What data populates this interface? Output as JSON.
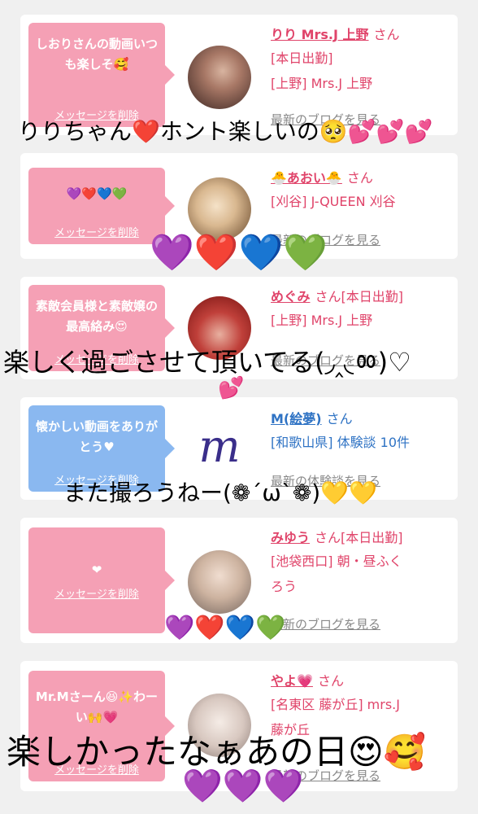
{
  "delete_label": "メッセージを削除",
  "cards": [
    {
      "bubble": "しおりさんの動画いつも楽しそ🥰",
      "bubble_color": "pink",
      "name": "りり Mrs.J 上野",
      "honorific": "さん",
      "lines": [
        "[本日出勤]",
        "[上野] Mrs.J 上野"
      ],
      "blog_link": "最新のブログを見る"
    },
    {
      "bubble": "💜❤️💙💚",
      "bubble_color": "pink",
      "name": "🐣あおい🐣",
      "honorific": "さん",
      "lines": [
        "[刈谷] J-QUEEN 刈谷"
      ],
      "blog_link": "最新のブログを見る"
    },
    {
      "bubble": "素敵会員様と素敵嬢の最高絡み😍",
      "bubble_color": "pink",
      "name": "めぐみ",
      "honorific": "さん[本日出勤]",
      "lines": [
        "[上野] Mrs.J 上野"
      ],
      "blog_link": "最新のブログを見る"
    },
    {
      "bubble": "懐かしい動画をありがとう♥",
      "bubble_color": "blue",
      "name": "M(絵夢)",
      "honorific": "さん",
      "lines": [
        "[和歌山県] 体験談 10件"
      ],
      "blog_link": "最新の体験談を見る"
    },
    {
      "bubble": "❤",
      "bubble_color": "pink",
      "name": "みゆう",
      "honorific": "さん[本日出勤]",
      "lines": [
        "[池袋西口] 朝・昼ふく",
        "ろう"
      ],
      "blog_link": "最新のブログを見る"
    },
    {
      "bubble": "Mr.Mさーん😆✨わーい🙌💗",
      "bubble_color": "pink",
      "name": "やよ💗",
      "honorific": "さん",
      "lines": [
        "[名東区 藤が丘] mrs.J",
        "藤が丘"
      ],
      "blog_link": "最新のブログを見る"
    }
  ],
  "overlays": [
    "りりちゃん❤️ホント楽しいの🥺💕💕💕",
    "💜❤️💙💚",
    "楽しく過ごさせて頂いてる(◞‸◟ㆀ)♡",
    "💕",
    "また撮ろうねー(❁´ω`❁)💛💛",
    "💜❤️💙💚",
    "楽しかったなぁあの日😍🥰",
    "💜💜💜"
  ],
  "avatar_letter": "m",
  "colors": {
    "pink_bubble": "#f5a0b5",
    "blue_bubble": "#8ab8f0",
    "pink_text": "#e0446a",
    "blue_text": "#2f73c4",
    "background": "#f0f0f0"
  }
}
